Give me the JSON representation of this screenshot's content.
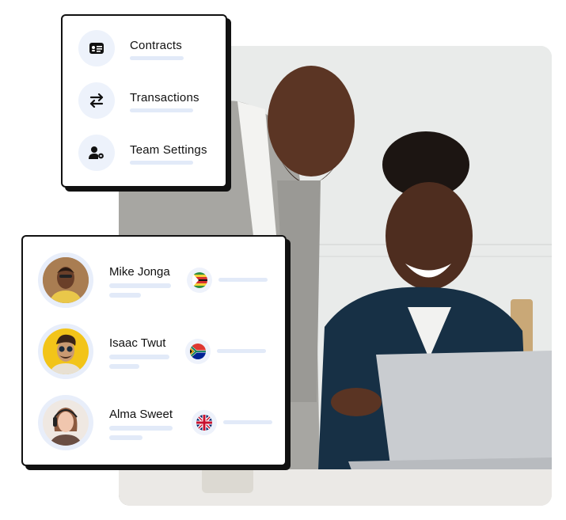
{
  "menu": {
    "items": [
      {
        "label": "Contracts",
        "icon": "id-card-icon"
      },
      {
        "label": "Transactions",
        "icon": "swap-arrows-icon"
      },
      {
        "label": "Team Settings",
        "icon": "user-gear-icon"
      }
    ]
  },
  "people": [
    {
      "name": "Mike Jonga",
      "flag": "zimbabwe-flag"
    },
    {
      "name": "Isaac Twut",
      "flag": "south-africa-flag"
    },
    {
      "name": "Alma Sweet",
      "flag": "united-kingdom-flag"
    }
  ],
  "colors": {
    "accent_light": "#edf2fb",
    "placeholder_bar": "#e2eaf8",
    "border": "#111111"
  }
}
